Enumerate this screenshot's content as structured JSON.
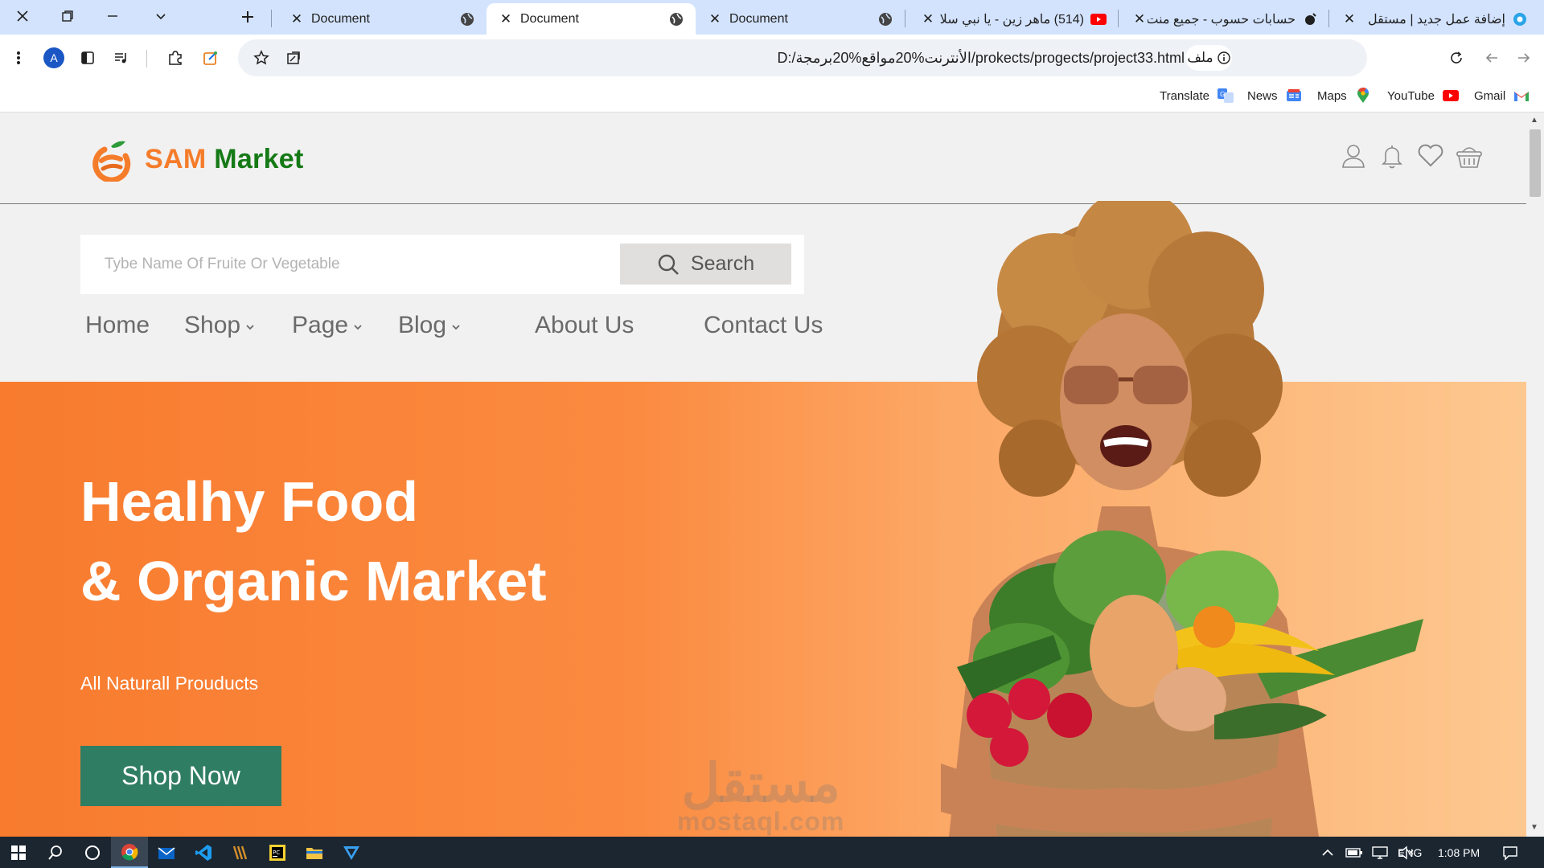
{
  "browser": {
    "tabs": [
      {
        "title": "Document",
        "active": false
      },
      {
        "title": "Document",
        "active": true
      },
      {
        "title": "Document",
        "active": false
      },
      {
        "title": "(514) ماهر زين - يا نبي سلا",
        "active": false
      },
      {
        "title": "حسابات حسوب - جميع منت",
        "active": false
      },
      {
        "title": "إضافة عمل جديد | مستقل",
        "active": false
      }
    ],
    "address": {
      "chip_label": "ملف",
      "url": "D:/الأنترنت%20مواقع%20برمجة/prokects/progects/project33.html"
    },
    "profile_initial": "A",
    "bookmarks": [
      {
        "label": "Translate",
        "icon": "google-translate-icon"
      },
      {
        "label": "News",
        "icon": "google-news-icon"
      },
      {
        "label": "Maps",
        "icon": "google-maps-icon"
      },
      {
        "label": "YouTube",
        "icon": "youtube-icon"
      },
      {
        "label": "Gmail",
        "icon": "gmail-icon"
      }
    ]
  },
  "site": {
    "logo": {
      "part1": "SAM",
      "part2": "Market"
    },
    "search": {
      "placeholder": "Tybe Name Of Fruite Or Vegetable",
      "button_label": "Search"
    },
    "nav": [
      {
        "label": "Home",
        "dropdown": false
      },
      {
        "label": "Shop",
        "dropdown": true
      },
      {
        "label": "Page",
        "dropdown": true
      },
      {
        "label": "Blog",
        "dropdown": true
      },
      {
        "label": "About Us",
        "dropdown": false
      },
      {
        "label": "Contact Us",
        "dropdown": false
      }
    ],
    "header_icons": [
      "user-icon",
      "bell-icon",
      "heart-icon",
      "basket-icon"
    ],
    "hero": {
      "title_line1": "Healhy Food",
      "title_line2": "& Organic Market",
      "subtitle": "All Naturall Prouducts",
      "cta": "Shop Now"
    },
    "watermark": {
      "arabic": "مستقل",
      "latin": "mostaql.com"
    }
  },
  "taskbar": {
    "language": "ENG",
    "time": "1:08 PM"
  },
  "colors": {
    "brand_orange": "#f57c2b",
    "brand_green": "#157a16",
    "cta_green": "#2f7d62",
    "hero_start": "#f87b2e",
    "hero_end": "#fdc890"
  }
}
